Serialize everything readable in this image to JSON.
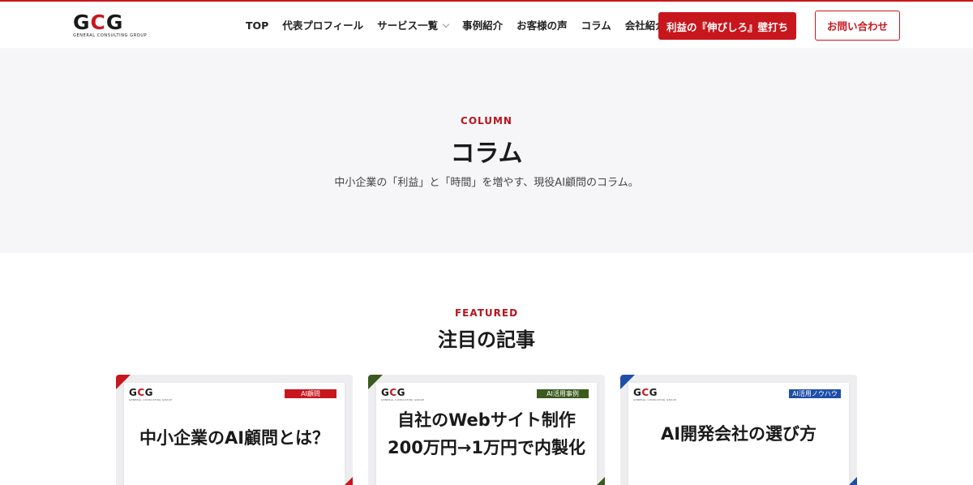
{
  "brand": {
    "logo_letters": [
      "G",
      "C",
      "G"
    ],
    "logo_sub": "GENERAL CONSULTING GROUP",
    "accent_color": "#c8161d"
  },
  "nav": {
    "items": [
      "TOP",
      "代表プロフィール",
      "サービス一覧",
      "事例紹介",
      "お客様の声",
      "コラム",
      "会社紹介"
    ],
    "has_dropdown_index": 2
  },
  "header": {
    "cta_primary": "利益の『伸びしろ』壁打ち",
    "cta_secondary": "お問い合わせ"
  },
  "hero": {
    "eyebrow": "COLUMN",
    "title": "コラム",
    "description": "中小企業の「利益」と「時間」を増やす、現役AI顧問のコラム。"
  },
  "featured": {
    "eyebrow": "FEATURED",
    "title": "注目の記事",
    "cards": [
      {
        "tag": "AI顧問",
        "tag_color": "#c8161d",
        "lines": [
          "中小企業のAI顧問とは？"
        ]
      },
      {
        "tag": "AI活用事例",
        "tag_color": "#3a5a1f",
        "lines": [
          "自社のWebサイト制作",
          "200万円→1万円で内製化"
        ]
      },
      {
        "tag": "AI活用ノウハウ",
        "tag_color": "#1e4fa8",
        "lines": [
          "AI開発会社の選び方"
        ]
      }
    ]
  }
}
